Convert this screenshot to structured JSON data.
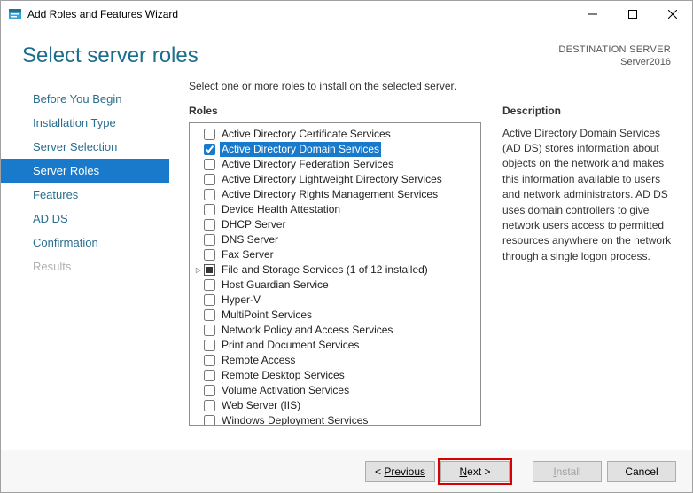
{
  "window": {
    "title": "Add Roles and Features Wizard"
  },
  "header": {
    "title": "Select server roles",
    "destLabel": "DESTINATION SERVER",
    "destValue": "Server2016"
  },
  "steps": [
    {
      "label": "Before You Begin",
      "state": "normal"
    },
    {
      "label": "Installation Type",
      "state": "normal"
    },
    {
      "label": "Server Selection",
      "state": "normal"
    },
    {
      "label": "Server Roles",
      "state": "active"
    },
    {
      "label": "Features",
      "state": "normal"
    },
    {
      "label": "AD DS",
      "state": "normal"
    },
    {
      "label": "Confirmation",
      "state": "normal"
    },
    {
      "label": "Results",
      "state": "disabled"
    }
  ],
  "main": {
    "instruction": "Select one or more roles to install on the selected server.",
    "rolesLabel": "Roles",
    "descLabel": "Description",
    "description": "Active Directory Domain Services (AD DS) stores information about objects on the network and makes this information available to users and network administrators. AD DS uses domain controllers to give network users access to permitted resources anywhere on the network through a single logon process."
  },
  "roles": [
    {
      "label": "Active Directory Certificate Services",
      "checked": false
    },
    {
      "label": "Active Directory Domain Services",
      "checked": true,
      "selected": true
    },
    {
      "label": "Active Directory Federation Services",
      "checked": false
    },
    {
      "label": "Active Directory Lightweight Directory Services",
      "checked": false
    },
    {
      "label": "Active Directory Rights Management Services",
      "checked": false
    },
    {
      "label": "Device Health Attestation",
      "checked": false
    },
    {
      "label": "DHCP Server",
      "checked": false
    },
    {
      "label": "DNS Server",
      "checked": false
    },
    {
      "label": "Fax Server",
      "checked": false
    },
    {
      "label": "File and Storage Services (1 of 12 installed)",
      "checked": "partial",
      "expandable": true
    },
    {
      "label": "Host Guardian Service",
      "checked": false
    },
    {
      "label": "Hyper-V",
      "checked": false
    },
    {
      "label": "MultiPoint Services",
      "checked": false
    },
    {
      "label": "Network Policy and Access Services",
      "checked": false
    },
    {
      "label": "Print and Document Services",
      "checked": false
    },
    {
      "label": "Remote Access",
      "checked": false
    },
    {
      "label": "Remote Desktop Services",
      "checked": false
    },
    {
      "label": "Volume Activation Services",
      "checked": false
    },
    {
      "label": "Web Server (IIS)",
      "checked": false
    },
    {
      "label": "Windows Deployment Services",
      "checked": false
    }
  ],
  "footer": {
    "previous": "Previous",
    "next": "Next >",
    "install": "Install",
    "cancel": "Cancel"
  }
}
